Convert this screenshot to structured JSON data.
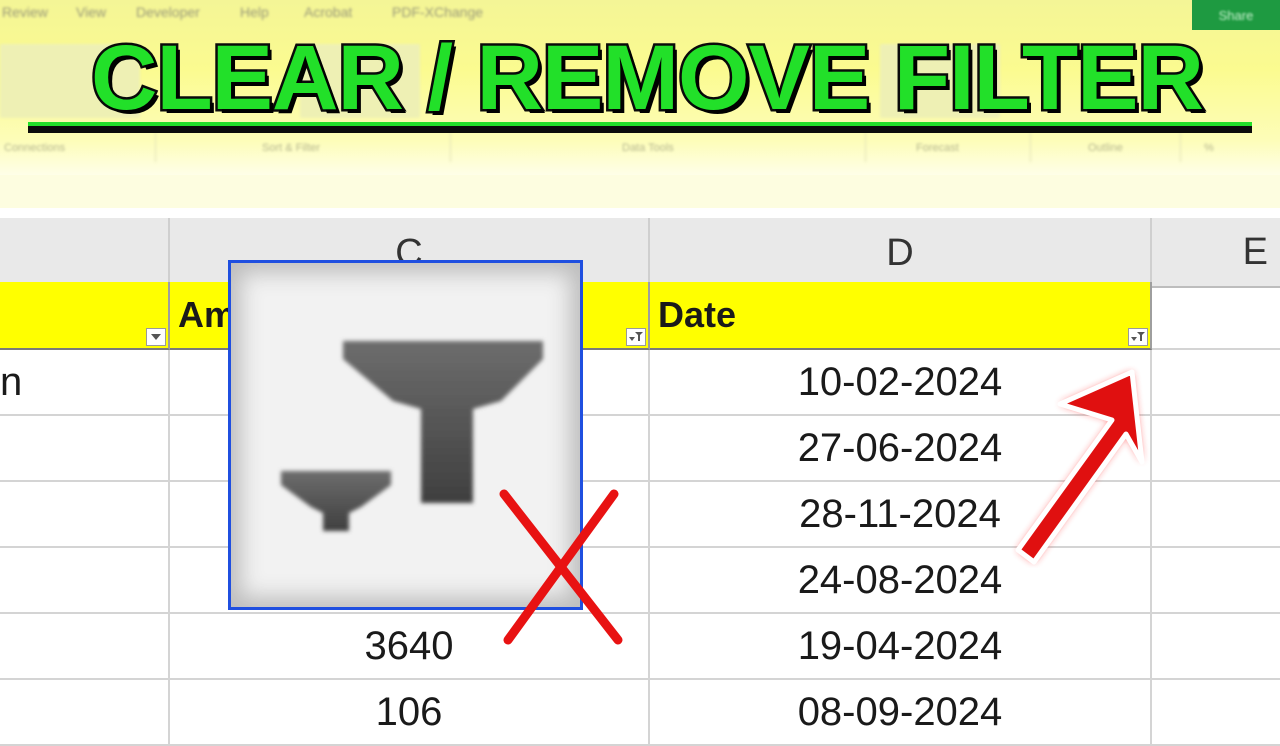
{
  "ribbon": {
    "menu": [
      "Review",
      "View",
      "Developer",
      "Help",
      "Acrobat",
      "PDF-XChange"
    ],
    "share_label": "Share",
    "groups": [
      "Connections",
      "Sort & Filter",
      "Data Tools",
      "Forecast",
      "Outline",
      "%"
    ]
  },
  "title": {
    "text": "CLEAR / REMOVE FILTER",
    "fill_color": "#22e029",
    "stroke_color": "#000000"
  },
  "sheet": {
    "columns": [
      "C",
      "D",
      "E"
    ],
    "header_row": {
      "col_b_text": "",
      "col_c_text": "Am",
      "col_d_text": "Date"
    },
    "partial_left_text": "n",
    "rows": [
      {
        "amount": "",
        "date": "10-02-2024"
      },
      {
        "amount": "",
        "date": "27-06-2024"
      },
      {
        "amount": "",
        "date": "28-11-2024"
      },
      {
        "amount": "",
        "date": "24-08-2024"
      },
      {
        "amount": "3640",
        "date": "19-04-2024"
      },
      {
        "amount": "106",
        "date": "08-09-2024"
      }
    ],
    "header_fill": "#ffff00"
  },
  "icons": {
    "zoom_icon": "clear-filter-icon",
    "cross": "red-x-icon",
    "arrow": "red-arrow-icon"
  },
  "colors": {
    "accent_blue": "#1f4fe0",
    "cross_red": "#e81212",
    "arrow_red": "#e01010"
  }
}
